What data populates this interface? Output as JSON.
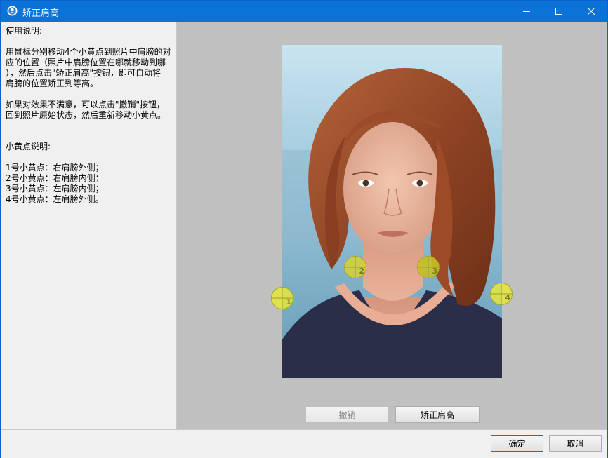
{
  "window": {
    "title": "矫正肩高",
    "app_icon": "app-logo-icon",
    "titlebar_color": "#0b73d8"
  },
  "instructions": {
    "heading": "使用说明:",
    "para1": "用鼠标分别移动4个小黄点到照片中肩膀的对\n应的位置（照片中肩膀位置在哪就移动到哪\n），然后点击\"矫正肩高\"按钮，即可自动将\n肩膀的位置矫正到等高。",
    "para2": "如果对效果不满意，可以点击\"撤销\"按钮，\n回到照片原始状态，然后重新移动小黄点。",
    "dots_heading": "小黄点说明:",
    "dots_list": "1号小黄点：右肩膀外侧；\n2号小黄点：右肩膀内侧；\n3号小黄点：左肩膀内侧；\n4号小黄点：左肩膀外侧。"
  },
  "dots": [
    {
      "label": "1"
    },
    {
      "label": "2"
    },
    {
      "label": "3"
    },
    {
      "label": "4"
    }
  ],
  "buttons": {
    "undo": "撤销",
    "correct": "矫正肩高",
    "ok": "确定",
    "cancel": "取消"
  },
  "colors": {
    "dot_fill": "#e6e63c",
    "canvas_bg": "#c0c0c0",
    "panel_bg": "#f0f0f0"
  }
}
